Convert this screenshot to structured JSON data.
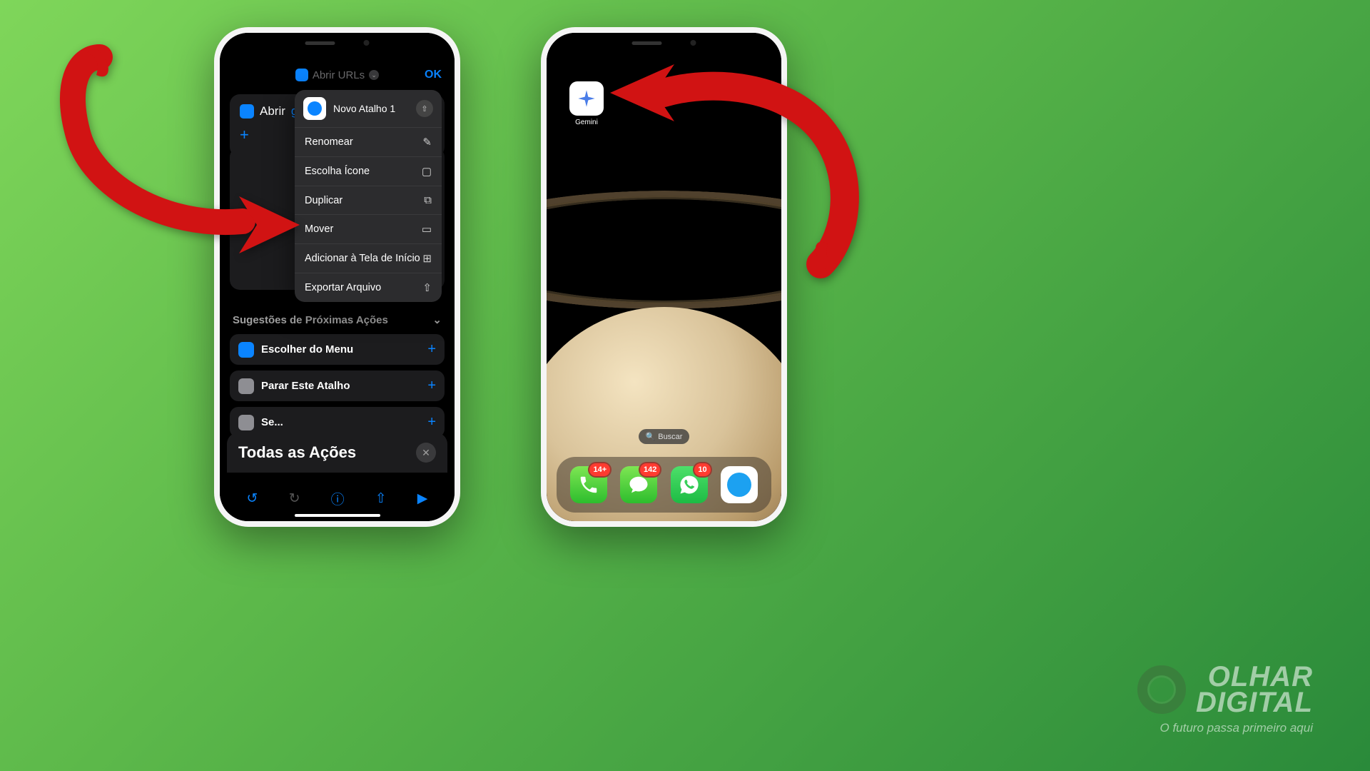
{
  "phone1": {
    "header": {
      "title": "Abrir URLs",
      "ok": "OK"
    },
    "action": {
      "verb": "Abrir",
      "url_placeholder": "g..."
    },
    "menu": {
      "title": "Novo Atalho 1",
      "items": [
        {
          "label": "Renomear",
          "icon": "✎"
        },
        {
          "label": "Escolha Ícone",
          "icon": "▢"
        },
        {
          "label": "Duplicar",
          "icon": "⧉"
        },
        {
          "label": "Mover",
          "icon": "▭"
        },
        {
          "label": "Adicionar à Tela de Início",
          "icon": "⊞"
        },
        {
          "label": "Exportar Arquivo",
          "icon": "⇧"
        }
      ]
    },
    "suggestions": {
      "header": "Sugestões de Próximas Ações",
      "items": [
        {
          "label": "Escolher do Menu",
          "color": "#0a84ff"
        },
        {
          "label": "Parar Este Atalho",
          "color": "#8e8e93"
        },
        {
          "label": "Se...",
          "color": "#8e8e93"
        }
      ]
    },
    "all_actions": {
      "title": "Todas as Ações"
    }
  },
  "phone2": {
    "app": {
      "label": "Gemini"
    },
    "search": "Buscar",
    "dock": [
      {
        "name": "phone",
        "badge": "14+"
      },
      {
        "name": "messages",
        "badge": "142"
      },
      {
        "name": "whatsapp",
        "badge": "10"
      },
      {
        "name": "safari",
        "badge": null
      }
    ]
  },
  "brand": {
    "name1": "OLHAR",
    "name2": "DIGITAL",
    "tagline": "O futuro passa primeiro aqui"
  }
}
